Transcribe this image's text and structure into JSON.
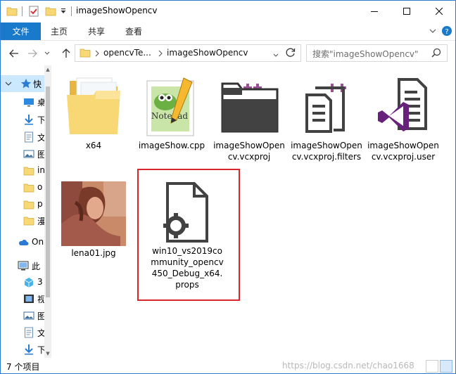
{
  "window": {
    "title": "imageShowOpencv",
    "controls": [
      "minimize-icon",
      "maximize-icon",
      "close-icon"
    ]
  },
  "ribbon": {
    "file_tab": "文件",
    "tabs": [
      "主页",
      "共享",
      "查看"
    ]
  },
  "address": {
    "crumbs": [
      "opencvTe...",
      "imageShowOpencv"
    ],
    "search_placeholder": "搜索\"imageShowOpencv\""
  },
  "navpane": {
    "items": [
      {
        "label": "快",
        "icon": "star-icon"
      },
      {
        "label": "桌",
        "icon": "desktop-icon"
      },
      {
        "label": "下",
        "icon": "download-icon"
      },
      {
        "label": "文",
        "icon": "document-icon"
      },
      {
        "label": "图",
        "icon": "picture-icon"
      },
      {
        "label": "in",
        "icon": "folder-icon"
      },
      {
        "label": "o",
        "icon": "folder-icon"
      },
      {
        "label": "p",
        "icon": "folder-icon"
      },
      {
        "label": "漫",
        "icon": "folder-icon"
      },
      {
        "label": "On",
        "icon": "cloud-icon"
      },
      {
        "label": "此",
        "icon": "pc-icon"
      },
      {
        "label": "3",
        "icon": "3d-icon"
      },
      {
        "label": "视",
        "icon": "video-icon"
      },
      {
        "label": "图",
        "icon": "picture-icon"
      },
      {
        "label": "文",
        "icon": "document-icon"
      },
      {
        "label": "下",
        "icon": "download-icon"
      }
    ]
  },
  "files": [
    {
      "name": "x64",
      "icon": "folder-icon"
    },
    {
      "name": "imageShow.cpp",
      "icon": "notepadpp-icon"
    },
    {
      "name": "imageShowOpencv.vcxproj",
      "icon": "vcxproj-icon"
    },
    {
      "name": "imageShowOpencv.vcxproj.filters",
      "icon": "vcxproj-filters-icon"
    },
    {
      "name": "imageShowOpencv.vcxproj.user",
      "icon": "vcxproj-user-icon"
    },
    {
      "name": "lena01.jpg",
      "icon": "image-thumbnail"
    },
    {
      "name": "win10_vs2019community_opencv450_Debug_x64.props",
      "icon": "props-file-icon"
    }
  ],
  "status": {
    "count": "7 个项目",
    "watermark": "https://blog.csdn.net/chao1668"
  },
  "colors": {
    "accent": "#1979ca",
    "selection_border": "#d9262c",
    "folder": "#f8d775",
    "vs_purple": "#68217a",
    "badge_purple": "#9b4f96"
  }
}
